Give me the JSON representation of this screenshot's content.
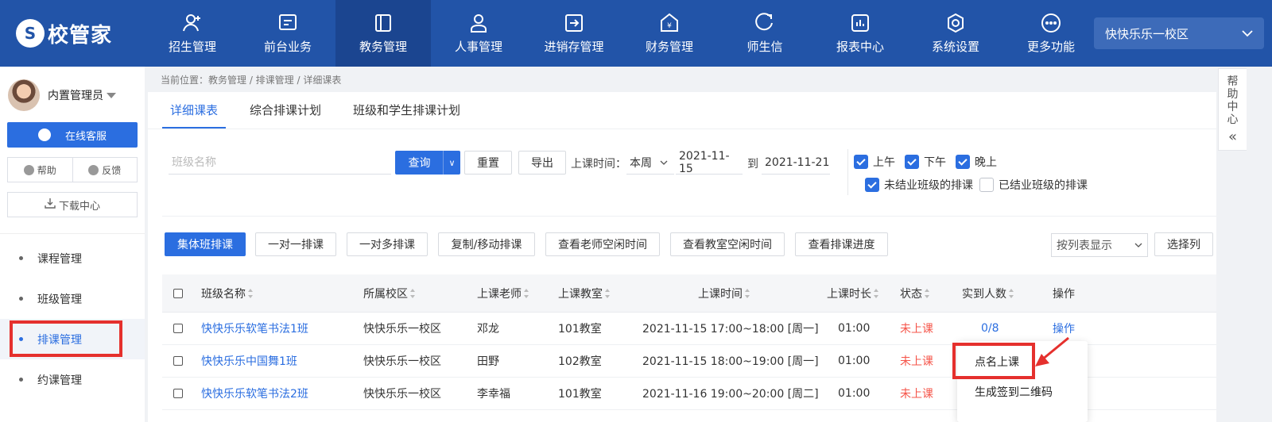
{
  "logo": {
    "text": "校管家"
  },
  "nav": [
    {
      "label": "招生管理",
      "icon": "user-plus-icon"
    },
    {
      "label": "前台业务",
      "icon": "window-icon"
    },
    {
      "label": "教务管理",
      "icon": "book-icon",
      "active": true
    },
    {
      "label": "人事管理",
      "icon": "person-icon"
    },
    {
      "label": "进销存管理",
      "icon": "inventory-icon"
    },
    {
      "label": "财务管理",
      "icon": "finance-icon"
    },
    {
      "label": "师生信",
      "icon": "chat-icon"
    },
    {
      "label": "报表中心",
      "icon": "report-icon"
    },
    {
      "label": "系统设置",
      "icon": "settings-icon"
    },
    {
      "label": "更多功能",
      "icon": "more-icon"
    }
  ],
  "campus": {
    "label": "快快乐乐一校区"
  },
  "sidebar": {
    "user_name": "内置管理员",
    "service_btn": "在线客服",
    "help": "帮助",
    "feedback": "反馈",
    "download": "下载中心",
    "menu": [
      {
        "label": "课程管理"
      },
      {
        "label": "班级管理"
      },
      {
        "label": "排课管理",
        "active": true
      },
      {
        "label": "约课管理"
      }
    ]
  },
  "breadcrumb": "当前位置：教务管理 / 排课管理 / 详细课表",
  "tabs": [
    "详细课表",
    "综合排课计划",
    "班级和学生排课计划"
  ],
  "filters": {
    "class_placeholder": "班级名称",
    "query": "查询",
    "reset": "重置",
    "export": "导出",
    "time_label": "上课时间：",
    "period": "本周",
    "date_from": "2021-11-15",
    "to": "到",
    "date_to": "2021-11-21",
    "morning": "上午",
    "afternoon": "下午",
    "evening": "晚上",
    "unfinished": "未结业班级的排课",
    "finished": "已结业班级的排课"
  },
  "actions": [
    "集体班排课",
    "一对一排课",
    "一对多排课",
    "复制/移动排课",
    "查看老师空闲时间",
    "查看教室空闲时间",
    "查看排课进度"
  ],
  "view_select": "按列表显示",
  "select_columns": "选择列",
  "table": {
    "headers": [
      "班级名称",
      "所属校区",
      "上课老师",
      "上课教室",
      "上课时间",
      "上课时长",
      "状态",
      "实到人数",
      "操作"
    ],
    "rows": [
      {
        "name": "快快乐乐软笔书法1班",
        "campus": "快快乐乐一校区",
        "teacher": "邓龙",
        "room": "101教室",
        "time": "2021-11-15 17:00~18:00 [周一]",
        "duration": "01:00",
        "status": "未上课",
        "attend": "0/8",
        "op": "操作"
      },
      {
        "name": "快快乐乐中国舞1班",
        "campus": "快快乐乐一校区",
        "teacher": "田野",
        "room": "102教室",
        "time": "2021-11-15 18:00~19:00 [周一]",
        "duration": "01:00",
        "status": "未上课",
        "attend": "",
        "op": ""
      },
      {
        "name": "快快乐乐软笔书法2班",
        "campus": "快快乐乐一校区",
        "teacher": "李幸福",
        "room": "101教室",
        "time": "2021-11-16 19:00~20:00 [周二]",
        "duration": "01:00",
        "status": "未上课",
        "attend": "",
        "op": ""
      }
    ]
  },
  "dropdown": [
    "点名上课",
    "生成签到二维码"
  ],
  "help_panel": [
    "帮",
    "助",
    "中",
    "心",
    "«"
  ],
  "colors": {
    "nav_bg": "#2254a8",
    "primary": "#2b6ee0",
    "highlight_red": "#e5302d",
    "status_red": "#f5554a"
  }
}
